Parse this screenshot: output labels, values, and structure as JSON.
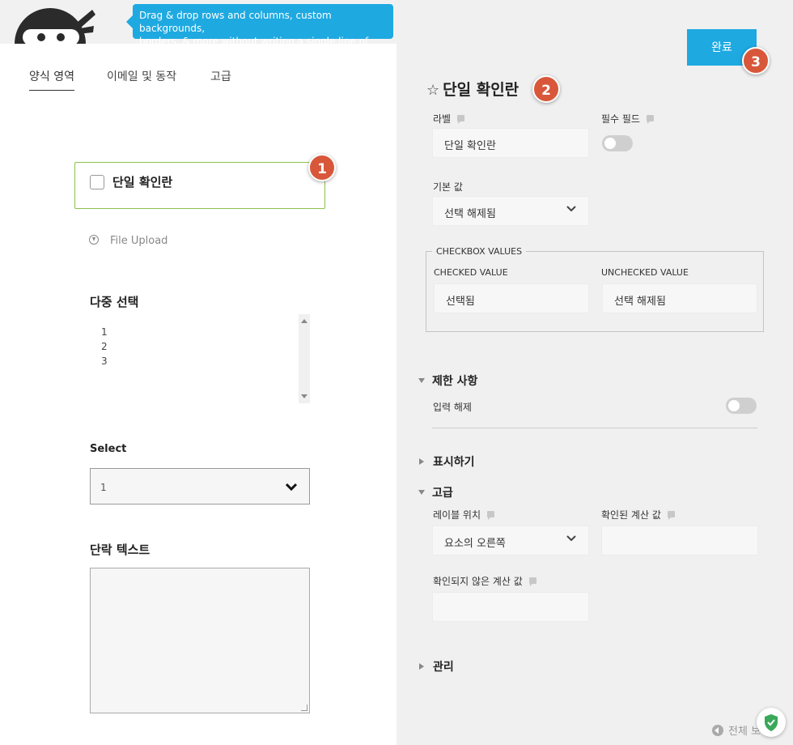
{
  "tooltip": {
    "text_line1": "Drag & drop rows and columns, custom backgrounds,",
    "text_line2": "borders, & more without writing a single line of code."
  },
  "tabs": [
    {
      "label": "양식 영역",
      "active": true
    },
    {
      "label": "이메일 및 동작",
      "active": false
    },
    {
      "label": "고급",
      "active": false
    }
  ],
  "form_fields": {
    "checkbox_label": "단일 확인란",
    "file_upload_label": "File Upload",
    "multi_select_title": "다중 선택",
    "multi_select_options": [
      "1",
      "2",
      "3"
    ],
    "select_title": "Select",
    "select_value": "1",
    "paragraph_title": "단락 텍스트"
  },
  "badges": {
    "b1": "1",
    "b2": "2",
    "b3": "3"
  },
  "panel": {
    "done_label": "완료",
    "title": "단일 확인란",
    "label_label": "라벨",
    "label_value": "단일 확인란",
    "required_label": "필수 필드",
    "required_on": false,
    "default_label": "기본 값",
    "default_value": "선택 해제됨",
    "cb_values_legend": "CHECKBOX VALUES",
    "checked_label": "CHECKED VALUE",
    "checked_value": "선택됨",
    "unchecked_label": "UNCHECKED VALUE",
    "unchecked_value": "선택 해제됨",
    "restrictions_head": "제한 사항",
    "disable_input_label": "입력 해제",
    "disable_input_on": false,
    "display_head": "표시하기",
    "advanced_head": "고급",
    "label_position_label": "레이블 위치",
    "label_position_value": "요소의 오른쪽",
    "checked_calc_label": "확인된 계산 값",
    "unchecked_calc_label": "확인되지 않은 계산 값",
    "admin_head": "관리",
    "expand_all": "전체 보"
  },
  "colors": {
    "accent": "#1ea9e1",
    "badge": "#d8573a",
    "active_field_border": "#8cc24b"
  }
}
